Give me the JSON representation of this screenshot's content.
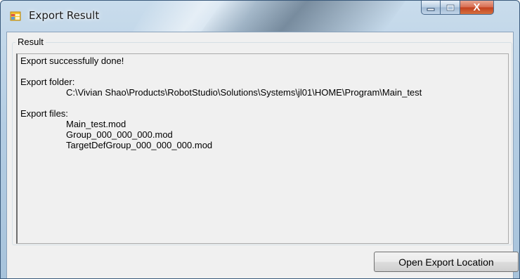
{
  "window": {
    "title": "Export Result",
    "icon": "application-form-icon",
    "caption_buttons": {
      "minimize": "minimize-icon",
      "maximize": "maximize-icon",
      "close": "close-icon",
      "close_glyph": "X"
    }
  },
  "result_group": {
    "label": "Result",
    "lines": {
      "status": "Export successfully done!",
      "folder_label": "Export folder:",
      "folder_path": "C:\\Vivian Shao\\Products\\RobotStudio\\Solutions\\Systems\\jl01\\HOME\\Program\\Main_test",
      "files_label": "Export files:",
      "files": [
        "Main_test.mod",
        "Group_000_000_000.mod",
        "TargetDefGroup_000_000_000.mod"
      ]
    }
  },
  "buttons": {
    "open_export_location": "Open Export Location"
  },
  "colors": {
    "accent_close": "#c2401f",
    "frame": "#b4cde3",
    "client_bg": "#f0f0f0"
  }
}
